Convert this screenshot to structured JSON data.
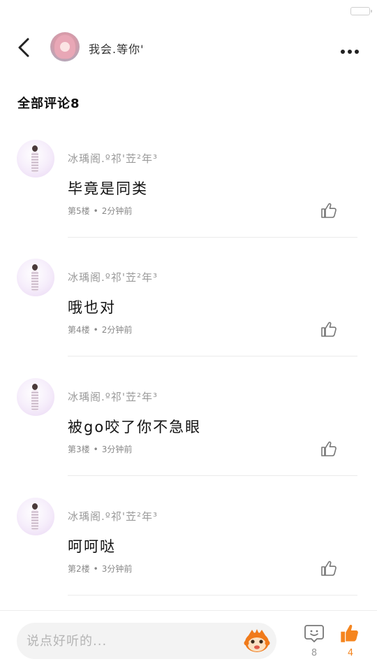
{
  "header": {
    "username": "我会.等你'"
  },
  "section": {
    "title": "全部评论8"
  },
  "comments": [
    {
      "user": "冰瑀阁.º祁'苙²年³",
      "text": "毕竟是同类",
      "floor": "第5楼",
      "time": "2分钟前"
    },
    {
      "user": "冰瑀阁.º祁'苙²年³",
      "text": "哦也对",
      "floor": "第4楼",
      "time": "2分钟前"
    },
    {
      "user": "冰瑀阁.º祁'苙²年³",
      "text": "被go咬了你不急眼",
      "floor": "第3楼",
      "time": "3分钟前"
    },
    {
      "user": "冰瑀阁.º祁'苙²年³",
      "text": "呵呵哒",
      "floor": "第2楼",
      "time": "3分钟前"
    }
  ],
  "bottom_bar": {
    "input_placeholder": "说点好听的...",
    "comment_count": "8",
    "like_count": "4"
  },
  "colors": {
    "accent": "#f5851f",
    "muted_text": "#9a9a9a",
    "divider": "#ebebeb"
  },
  "icons": [
    "back-arrow-icon",
    "more-dots-icon",
    "thumbs-up-icon",
    "comment-bubble-icon",
    "monkey-emoji-icon",
    "battery-icon"
  ]
}
